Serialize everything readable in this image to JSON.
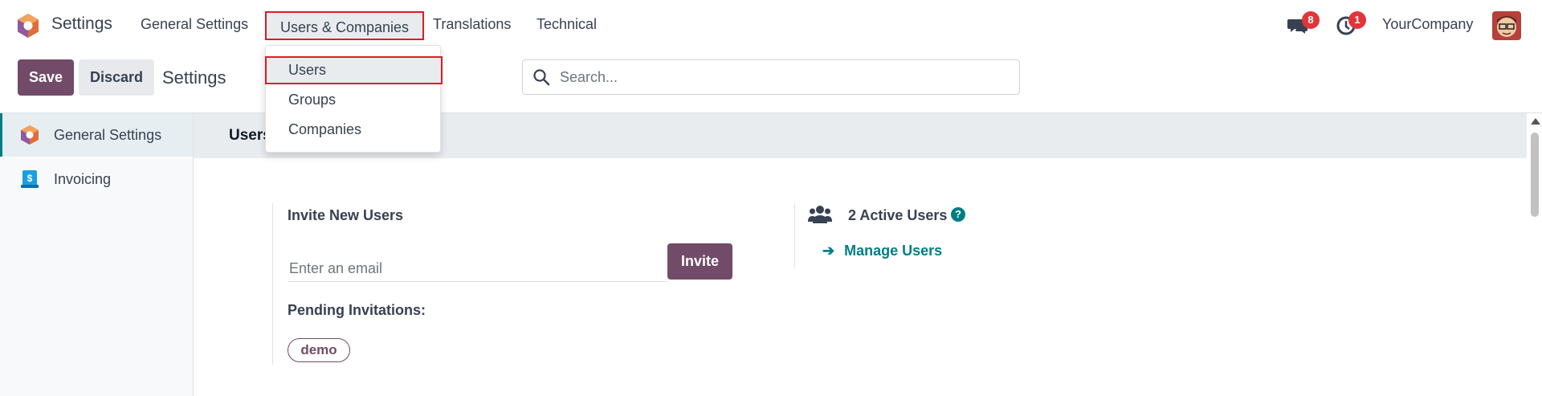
{
  "navbar": {
    "app_name": "Settings",
    "menu": [
      "General Settings",
      "Users & Companies",
      "Translations",
      "Technical"
    ],
    "messages_badge": "8",
    "activities_badge": "1",
    "company": "YourCompany"
  },
  "dropdown": {
    "items": [
      "Users",
      "Groups",
      "Companies"
    ]
  },
  "controlbar": {
    "save_label": "Save",
    "discard_label": "Discard",
    "breadcrumb": "Settings",
    "search_placeholder": "Search..."
  },
  "sidebar": {
    "items": [
      {
        "label": "General Settings",
        "icon": "settings-app-icon",
        "active": true
      },
      {
        "label": "Invoicing",
        "icon": "invoicing-app-icon",
        "active": false
      }
    ]
  },
  "section": {
    "title": "Users"
  },
  "invite": {
    "heading": "Invite New Users",
    "email_placeholder": "Enter an email",
    "invite_label": "Invite",
    "pending_label": "Pending Invitations:",
    "pending": [
      "demo"
    ]
  },
  "users": {
    "active_users": "2 Active Users",
    "help": "?",
    "manage_label": "Manage Users"
  },
  "colors": {
    "primary": "#714b67",
    "accent": "#017e84",
    "badge": "#e0363a",
    "highlight_border": "#e01b24"
  }
}
